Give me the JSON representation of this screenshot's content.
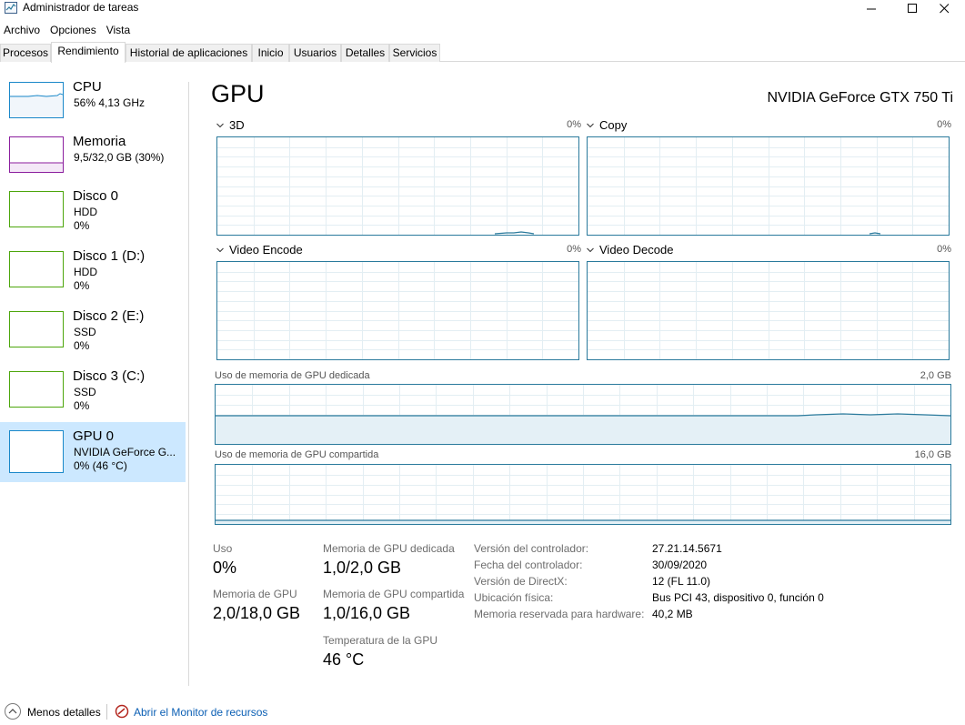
{
  "window": {
    "title": "Administrador de tareas",
    "icon": "task-manager-icon"
  },
  "menu": [
    "Archivo",
    "Opciones",
    "Vista"
  ],
  "tabs": [
    "Procesos",
    "Rendimiento",
    "Historial de aplicaciones",
    "Inicio",
    "Usuarios",
    "Detalles",
    "Servicios"
  ],
  "active_tab": "Rendimiento",
  "sidebar": {
    "items": [
      {
        "name": "CPU",
        "line2": "56% 4,13 GHz",
        "line3": "",
        "color": "#1a88c9"
      },
      {
        "name": "Memoria",
        "line2": "9,5/32,0 GB (30%)",
        "line3": "",
        "color": "#8b1e9e"
      },
      {
        "name": "Disco 0",
        "line2": "HDD",
        "line3": "0%",
        "color": "#4da60c"
      },
      {
        "name": "Disco 1 (D:)",
        "line2": "HDD",
        "line3": "0%",
        "color": "#4da60c"
      },
      {
        "name": "Disco 2 (E:)",
        "line2": "SSD",
        "line3": "0%",
        "color": "#4da60c"
      },
      {
        "name": "Disco 3 (C:)",
        "line2": "SSD",
        "line3": "0%",
        "color": "#4da60c"
      },
      {
        "name": "GPU 0",
        "line2": "NVIDIA GeForce G...",
        "line3": "0% (46 °C)",
        "color": "#1a88c9"
      }
    ],
    "selected_index": 6
  },
  "main": {
    "title": "GPU",
    "device": "NVIDIA GeForce GTX 750 Ti",
    "engines": [
      {
        "label": "3D",
        "pct": "0%"
      },
      {
        "label": "Copy",
        "pct": "0%"
      },
      {
        "label": "Video Encode",
        "pct": "0%"
      },
      {
        "label": "Video Decode",
        "pct": "0%"
      }
    ],
    "dedicated_memory": {
      "label": "Uso de memoria de GPU dedicada",
      "max": "2,0 GB"
    },
    "shared_memory": {
      "label": "Uso de memoria de GPU compartida",
      "max": "16,0 GB"
    },
    "stats": {
      "uso_label": "Uso",
      "uso_value": "0%",
      "ded_label": "Memoria de GPU dedicada",
      "ded_value": "1,0/2,0 GB",
      "gpu_mem_label": "Memoria de GPU",
      "gpu_mem_value": "2,0/18,0 GB",
      "shared_label": "Memoria de GPU compartida",
      "shared_value": "1,0/16,0 GB",
      "temp_label": "Temperatura de la GPU",
      "temp_value": "46 °C"
    },
    "details": [
      {
        "key": "Versión del controlador:",
        "value": "27.21.14.5671"
      },
      {
        "key": "Fecha del controlador:",
        "value": "30/09/2020"
      },
      {
        "key": "Versión de DirectX:",
        "value": "12 (FL 11.0)"
      },
      {
        "key": "Ubicación física:",
        "value": "Bus PCI 43, dispositivo 0, función 0"
      },
      {
        "key": "Memoria reservada para hardware:",
        "value": "40,2 MB"
      }
    ]
  },
  "footer": {
    "less_details": "Menos detalles",
    "monitor_link": "Abrir el Monitor de recursos"
  },
  "colors": {
    "accent": "#2a7a9c",
    "selection": "#cce8ff",
    "link": "#0b5fb4"
  }
}
